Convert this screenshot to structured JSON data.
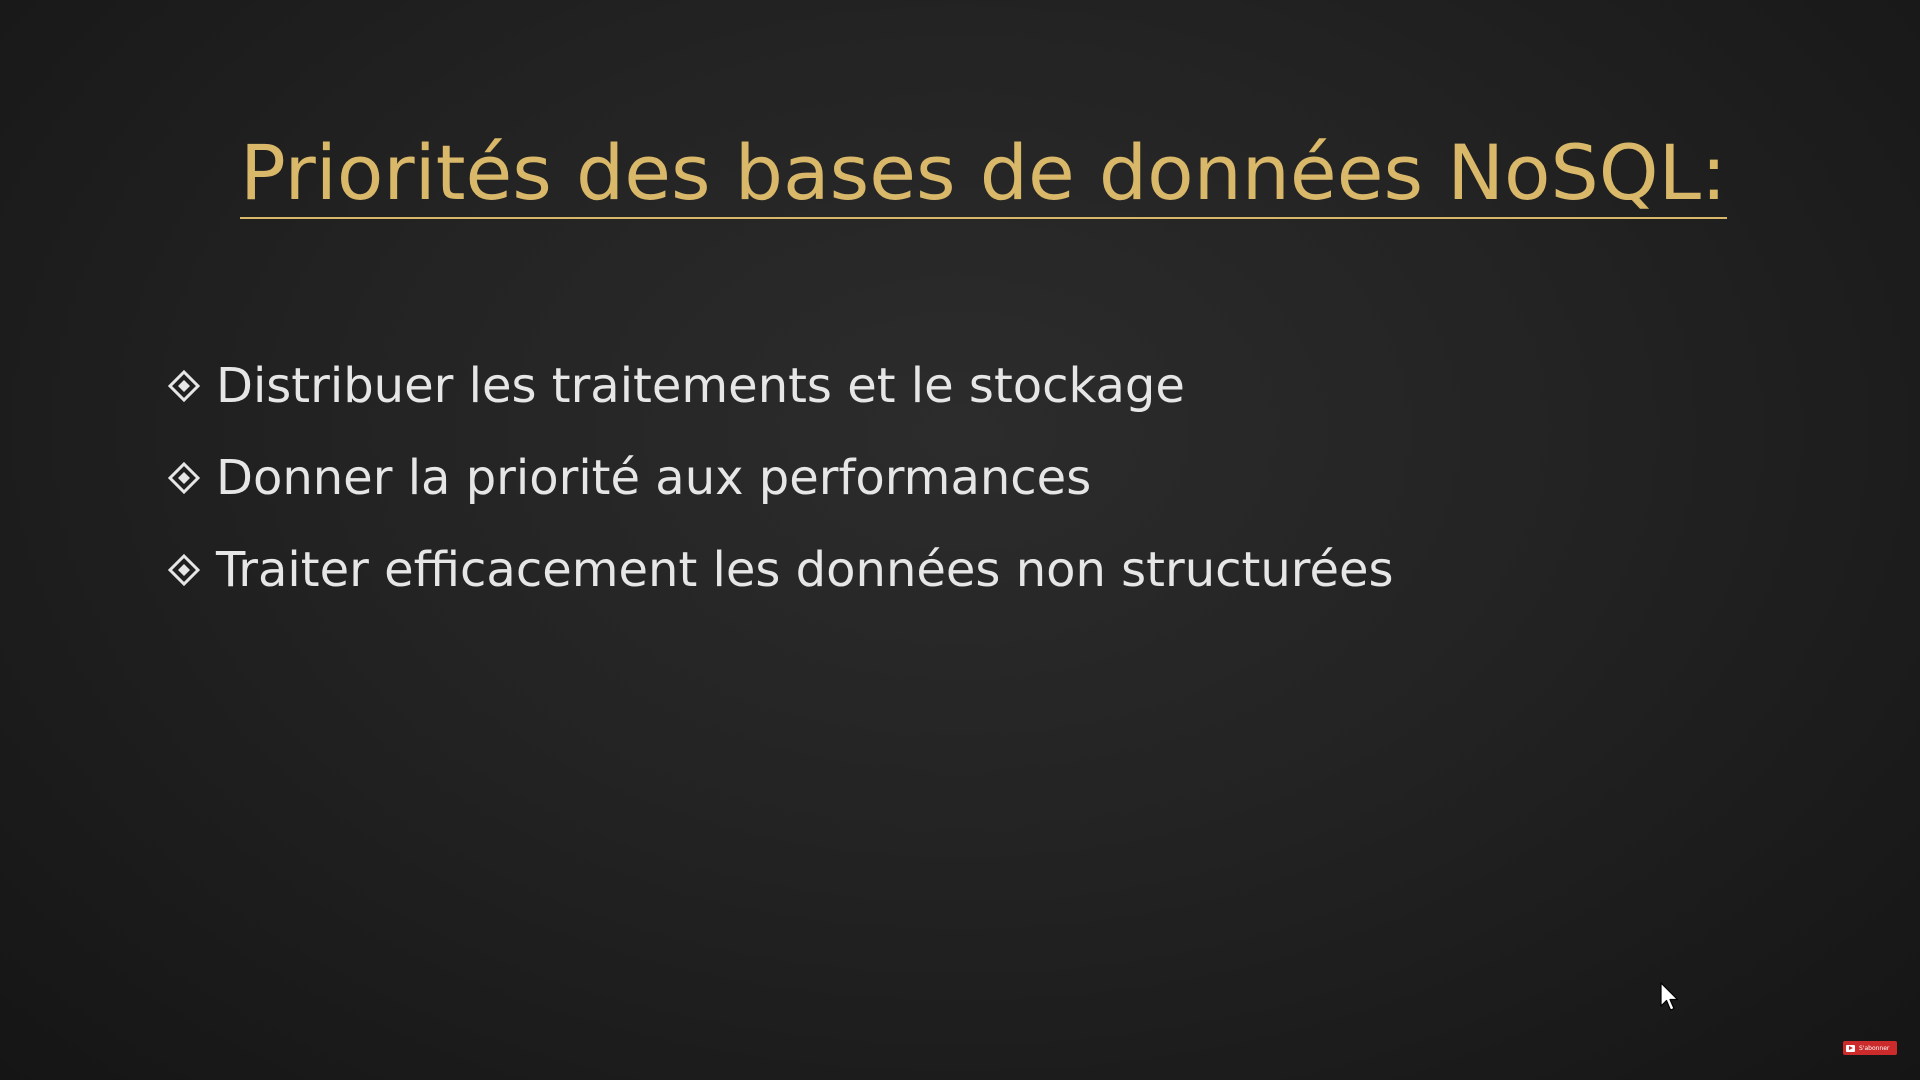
{
  "slide": {
    "title": "Priorités des bases de données NoSQL:",
    "bullet_icon": "diamond-bullet-icon",
    "bullets": [
      "Distribuer les traitements et le stockage",
      "Donner la priorité aux performances",
      "Traiter efficacement les données non structurées"
    ]
  },
  "overlay": {
    "cursor_icon": "mouse-pointer-icon",
    "subscribe_label": "S'abonner"
  },
  "colors": {
    "background": "#1b1b1b",
    "title": "#d9b86a",
    "bullet_text": "#e6e6e6",
    "subscribe_badge": "#cc2b2b"
  }
}
